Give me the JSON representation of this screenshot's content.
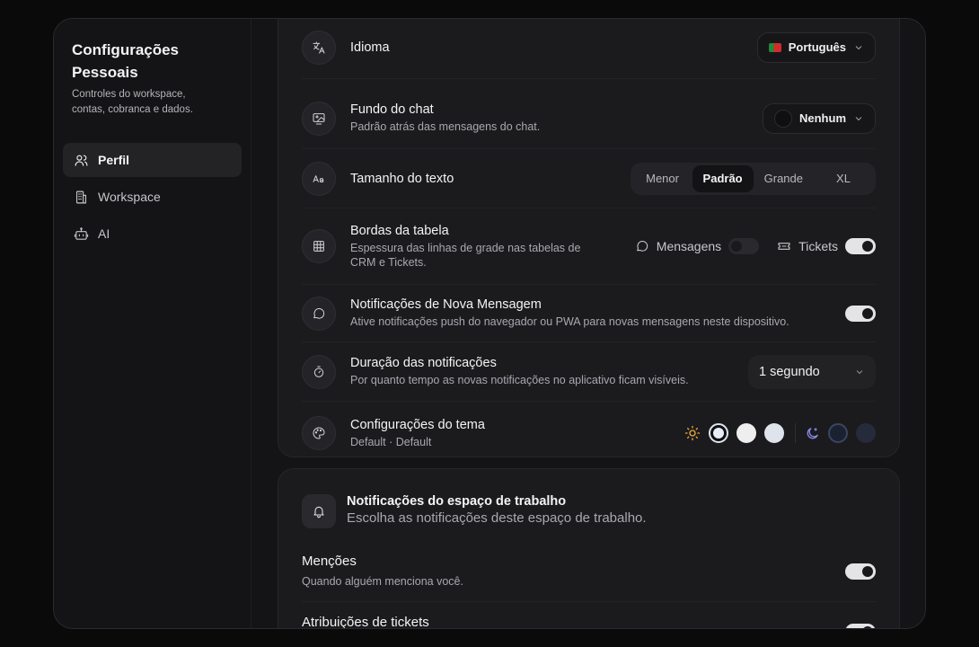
{
  "sidebar": {
    "title_line1": "Configurações",
    "title_line2": "Pessoais",
    "subtitle_line1": "Controles do workspace,",
    "subtitle_line2": "contas, cobranca e dados.",
    "items": [
      {
        "label": "Perfil",
        "icon": "users-icon",
        "active": true
      },
      {
        "label": "Workspace",
        "icon": "building-icon",
        "active": false
      },
      {
        "label": "AI",
        "icon": "bot-icon",
        "active": false
      }
    ]
  },
  "settings": {
    "language": {
      "title": "Idioma",
      "value": "Português"
    },
    "chat_background": {
      "title": "Fundo do chat",
      "desc": "Padrão atrás das mensagens do chat.",
      "value": "Nenhum"
    },
    "text_size": {
      "title": "Tamanho do texto",
      "options": [
        "Menor",
        "Padrão",
        "Grande",
        "XL"
      ],
      "selected": "Padrão"
    },
    "table_borders": {
      "title": "Bordas da tabela",
      "desc_line1": "Espessura das linhas de grade nas tabelas de",
      "desc_line2": "CRM e Tickets.",
      "messages_label": "Mensagens",
      "messages_on": false,
      "tickets_label": "Tickets",
      "tickets_on": true
    },
    "new_message_notifications": {
      "title": "Notificações de Nova Mensagem",
      "desc": "Ative notificações push do navegador ou PWA para novas mensagens neste dispositivo.",
      "on": true
    },
    "notification_duration": {
      "title": "Duração das notificações",
      "desc": "Por quanto tempo as novas notificações no aplicativo ficam visíveis.",
      "value": "1 segundo"
    },
    "theme": {
      "title": "Configurações do tema",
      "desc": "Default · Default",
      "light_swatches": [
        "#e8edf5",
        "#eeeeee",
        "#dfe4ec"
      ],
      "dark_swatches": [
        "#1a2130",
        "#252b3a"
      ],
      "selected_light": 0
    }
  },
  "workspace_notifications": {
    "title": "Notificações do espaço de trabalho",
    "desc": "Escolha as notificações deste espaço de trabalho.",
    "mentions": {
      "title": "Menções",
      "desc": "Quando alguém menciona você.",
      "on": true
    },
    "ticket_assignments": {
      "title": "Atribuições de tickets"
    }
  }
}
